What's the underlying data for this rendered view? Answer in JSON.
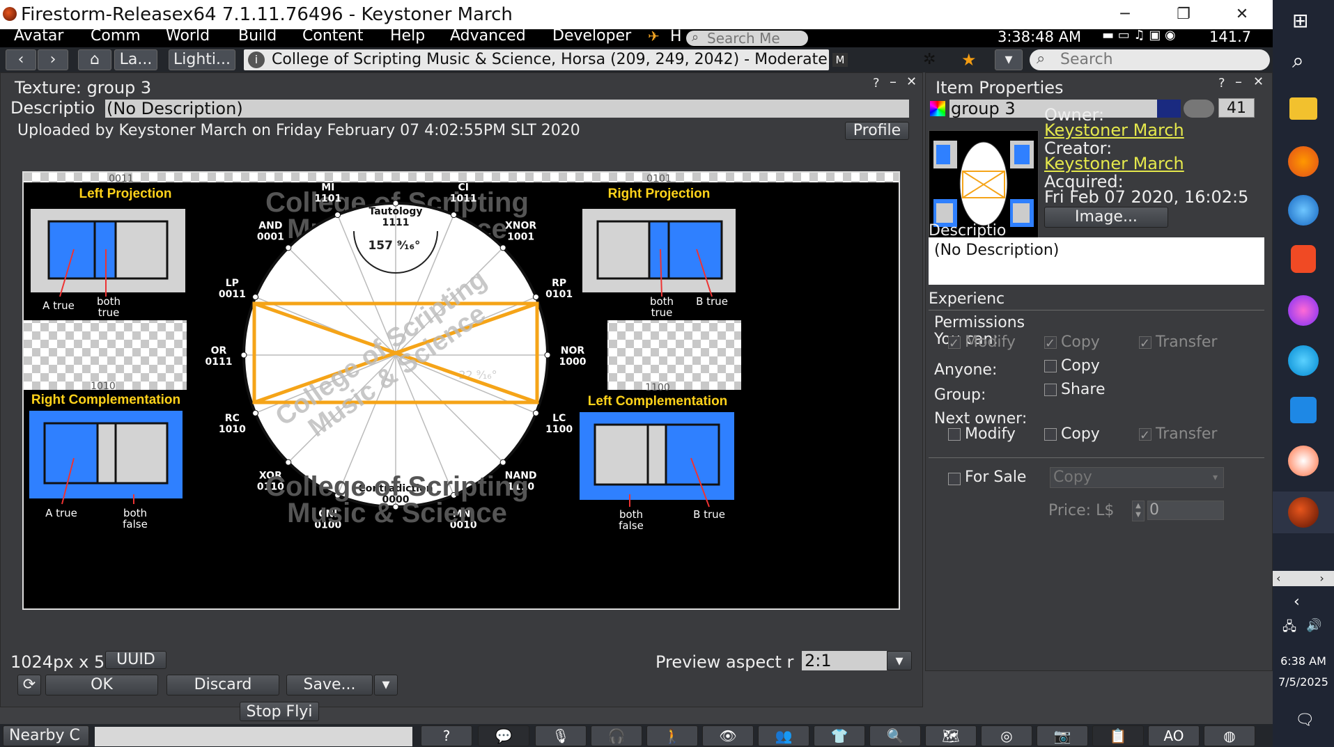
{
  "window": {
    "title": "Firestorm-Releasex64 7.1.11.76496 - Keystoner March",
    "minimize": "─",
    "restore": "❐",
    "close": "✕"
  },
  "menu": {
    "items": [
      "Avatar",
      "Comm",
      "World",
      "Build",
      "Content",
      "Help",
      "Advanced",
      "Developer"
    ],
    "h_label": "H",
    "search_placeholder": "Search Me",
    "clock": "3:38:48 AM",
    "balance": "141.7"
  },
  "nav": {
    "tab1": "La...",
    "tab2": "Lighti...",
    "location": "College of Scripting Music & Science, Horsa (209, 249, 2042) - Moderate",
    "rating_badge": "M",
    "search_placeholder": "Search"
  },
  "texture": {
    "title": "Texture: group 3",
    "desc_label": "Descriptio",
    "desc_value": "(No Description)",
    "uploaded": "Uploaded by Keystoner March on Friday February 07 4:02:55PM SLT 2020",
    "profile_btn": "Profile",
    "size": "1024px x 5",
    "uuid_btn": "UUID",
    "preview_label": "Preview aspect r",
    "preview_value": "2:1",
    "ok": "OK",
    "discard": "Discard",
    "save": "Save...",
    "stop_fly": "Stop Flyi"
  },
  "image": {
    "watermark1": "College of Scripting",
    "watermark2": "Music & Science",
    "angle_top": "157 ⁹⁄₁₆°",
    "angle_right": "22 ⁹⁄₁₆°",
    "panels": {
      "tl": {
        "code": "0011",
        "title": "Left Projection",
        "a": "A true",
        "b1": "both",
        "b2": "true"
      },
      "tr": {
        "code": "0101",
        "title": "Right Projection",
        "a1": "both",
        "a2": "true",
        "b": "B true"
      },
      "bl": {
        "code": "1010",
        "title": "Right Complementation",
        "a": "A true",
        "b1": "both",
        "b2": "false"
      },
      "br": {
        "code": "1100",
        "title": "Left Complementation",
        "a1": "both",
        "a2": "false",
        "b": "B true"
      }
    },
    "nodes": [
      {
        "name": "Tautology",
        "code": "1111"
      },
      {
        "name": "CI",
        "code": "1011"
      },
      {
        "name": "XNOR",
        "code": "1001"
      },
      {
        "name": "RP",
        "code": "0101"
      },
      {
        "name": "NOR",
        "code": "1000"
      },
      {
        "name": "LC",
        "code": "1100"
      },
      {
        "name": "NAND",
        "code": "1110"
      },
      {
        "name": "MNI",
        "code": "0010"
      },
      {
        "name": "Contradiction",
        "code": "0000"
      },
      {
        "name": "CNI",
        "code": "0100"
      },
      {
        "name": "XOR",
        "code": "0110"
      },
      {
        "name": "RC",
        "code": "1010"
      },
      {
        "name": "OR",
        "code": "0111"
      },
      {
        "name": "LP",
        "code": "0011"
      },
      {
        "name": "AND",
        "code": "0001"
      },
      {
        "name": "MI",
        "code": "1101"
      }
    ]
  },
  "props": {
    "title": "Item Properties",
    "name_value": "group 3",
    "count": "41",
    "owner_label": "Owner:",
    "owner": "Keystoner March",
    "creator_label": "Creator:",
    "creator": "Keystoner March",
    "acquired_label": "Acquired:",
    "acquired": "Fri Feb 07 2020, 16:02:5",
    "image_btn": "Image...",
    "desc_label": "Descriptio",
    "desc_value": "(No Description)",
    "experience_label": "Experienc",
    "permissions": "Permissions",
    "you_can": "You can:",
    "modify": "Modify",
    "copy": "Copy",
    "transfer": "Transfer",
    "anyone": "Anyone:",
    "group": "Group:",
    "share": "Share",
    "next_owner": "Next owner:",
    "for_sale": "For Sale",
    "sale_type": "Copy",
    "price_label": "Price: L$",
    "price": "0"
  },
  "bottom": {
    "nearby": "Nearby C",
    "ao": "AO"
  },
  "taskbar": {
    "time": "6:38 AM",
    "date": "7/5/2025"
  }
}
